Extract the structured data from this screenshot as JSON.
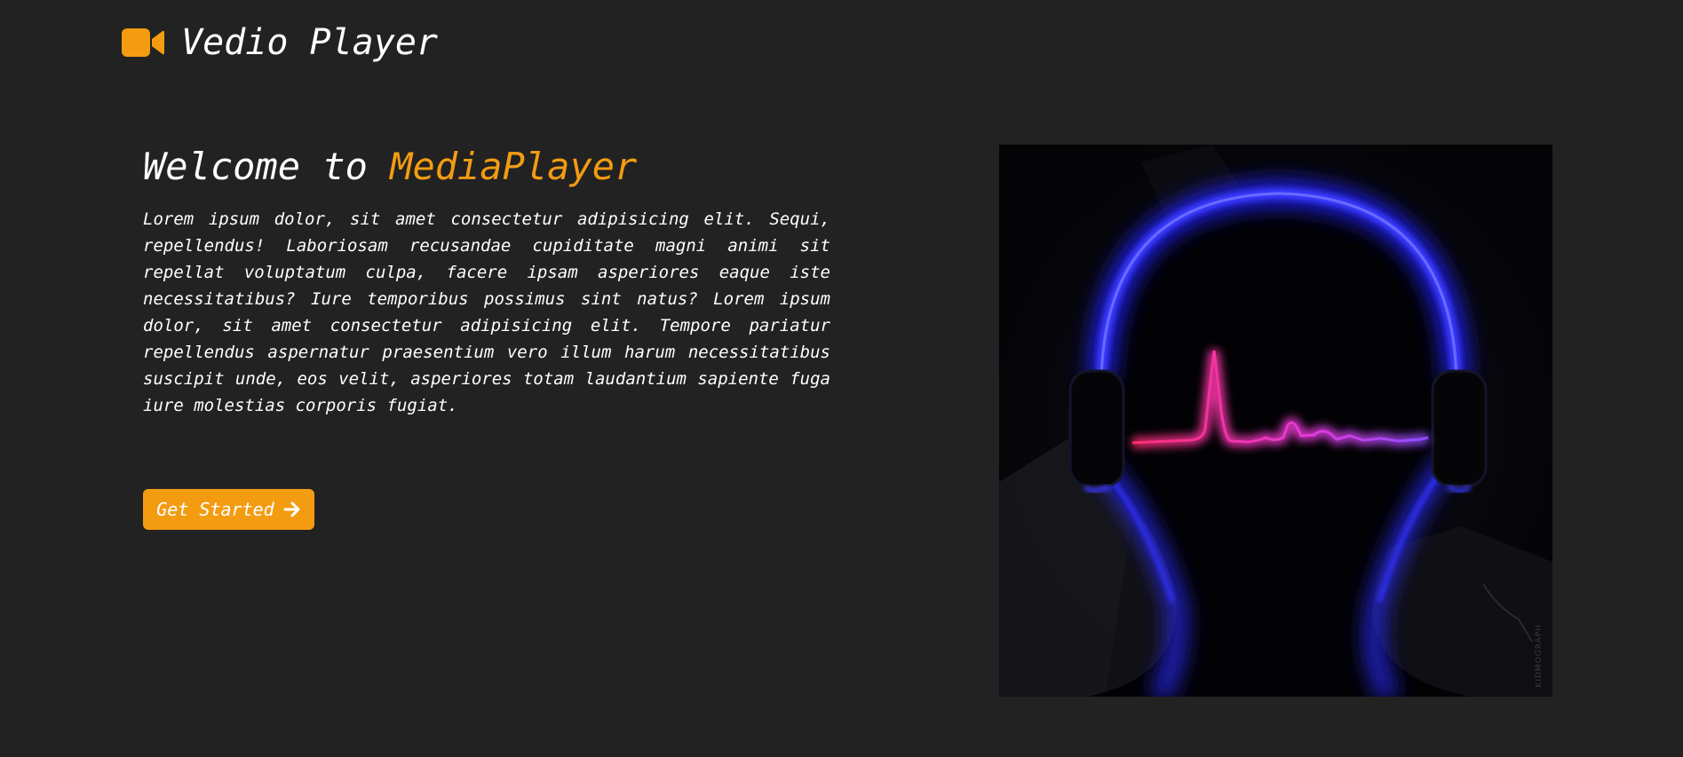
{
  "header": {
    "brand": "Vedio Player",
    "logo_icon": "video-camera-icon",
    "accent_color": "#f39c12"
  },
  "hero": {
    "title_prefix": "Welcome to ",
    "title_accent": "MediaPlayer",
    "description": "Lorem ipsum dolor, sit amet consectetur adipisicing elit. Sequi, repellendus! Laboriosam recusandae cupiditate magni animi sit repellat voluptatum culpa, facere ipsam asperiores eaque iste necessitatibus? Iure temporibus possimus sint natus? Lorem ipsum dolor, sit amet consectetur adipisicing elit. Tempore pariatur repellendus aspernatur praesentium vero illum harum necessitatibus suscipit unde, eos velit, asperiores totam laudantium sapiente fuga iure molestias corporis fugiat.",
    "cta_label": "Get Started",
    "cta_icon": "arrow-right-icon",
    "image_watermark": "KIDMOGRAPH"
  },
  "colors": {
    "background": "#222222",
    "accent": "#f39c12",
    "text": "#ffffff"
  }
}
